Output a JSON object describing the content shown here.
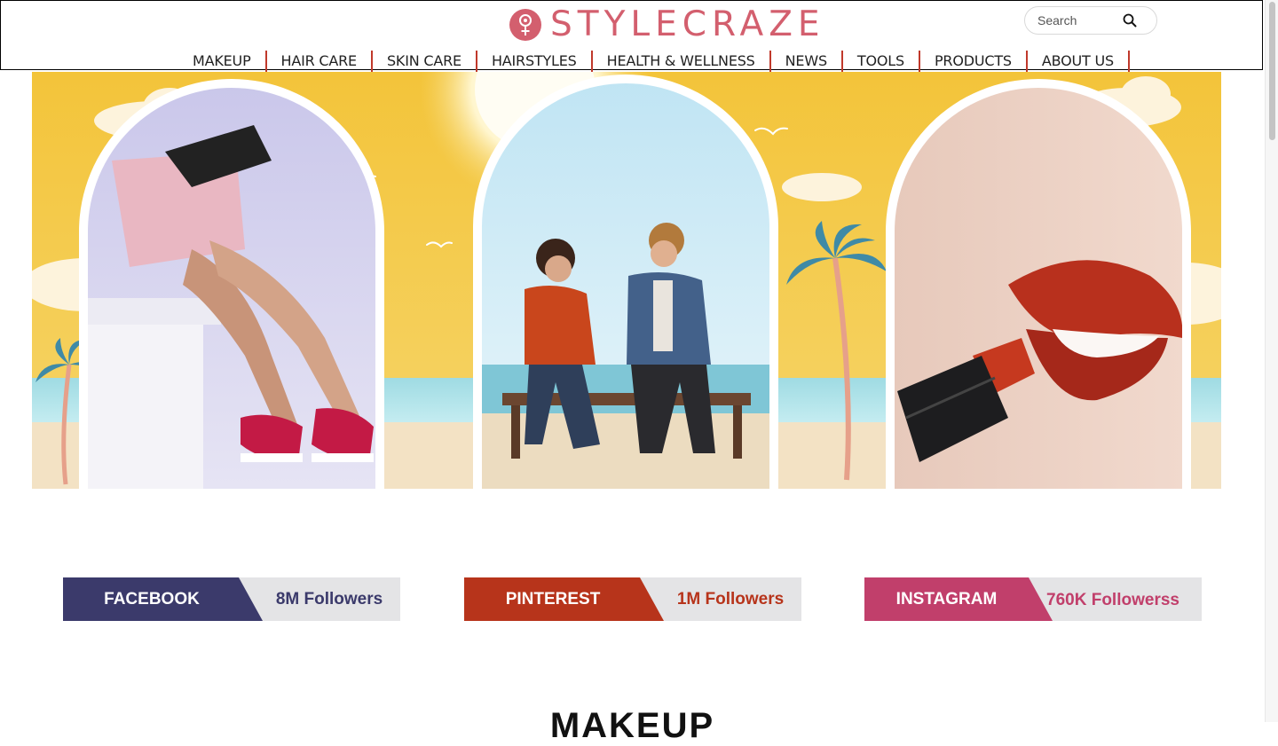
{
  "header": {
    "brand": "STYLECRAZE",
    "search_placeholder": "Search"
  },
  "nav": {
    "items": [
      "MAKEUP",
      "HAIR CARE",
      "SKIN CARE",
      "HAIRSTYLES",
      "HEALTH & WELLNESS",
      "NEWS",
      "TOOLS",
      "PRODUCTS",
      "ABOUT US"
    ]
  },
  "social": {
    "facebook": {
      "label": "FACEBOOK",
      "followers": "8M Followers",
      "color": "#3b3a6b"
    },
    "pinterest": {
      "label": "PINTEREST",
      "followers": "1M Followers",
      "color": "#b7341b"
    },
    "instagram": {
      "label": "INSTAGRAM",
      "followers": "760K Followerss",
      "color": "#c13f6b"
    }
  },
  "sections": {
    "makeup_title": "MAKEUP"
  },
  "colors": {
    "brand": "#d35f6e",
    "nav_divider": "#c0392b",
    "sky": "#f1c93c"
  }
}
